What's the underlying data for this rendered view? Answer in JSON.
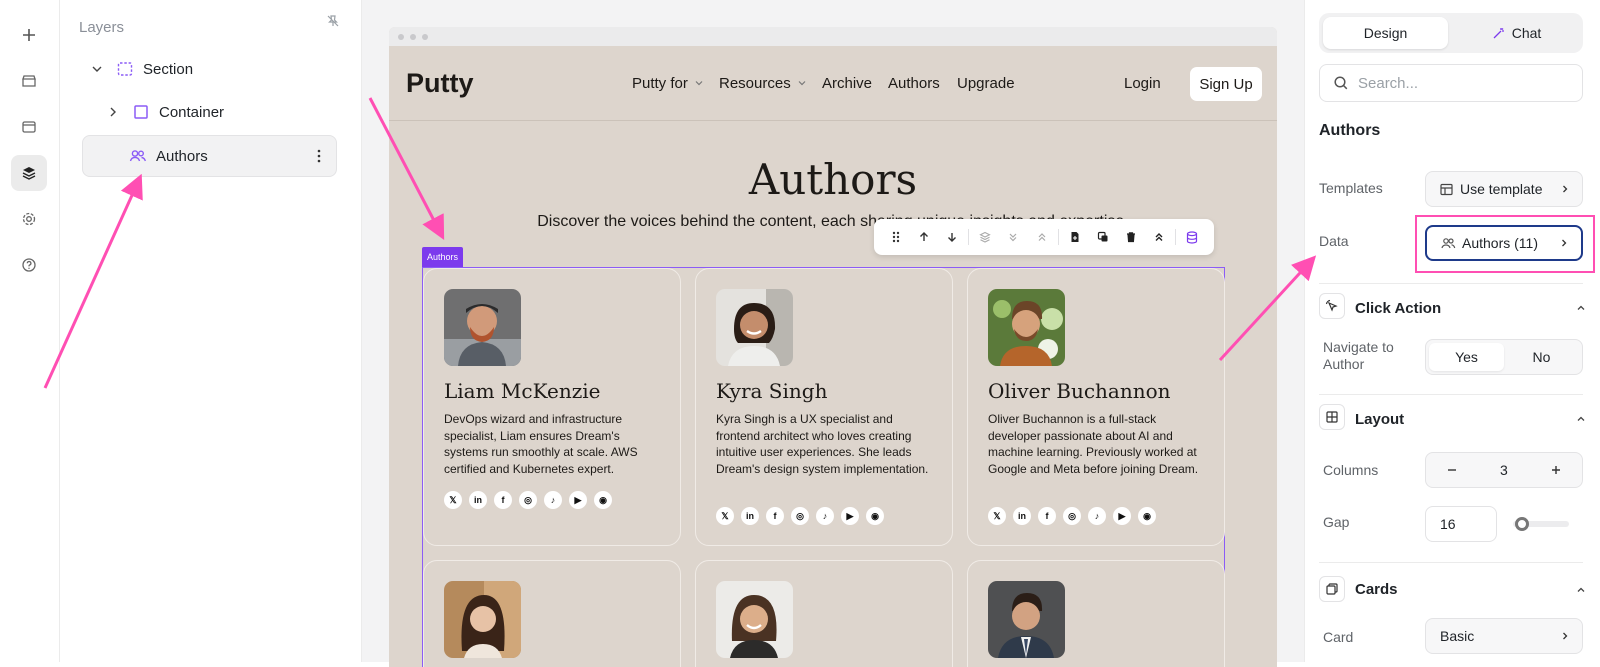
{
  "rail": {
    "icons": [
      "plus-icon",
      "box-icon",
      "window-icon",
      "layers-icon",
      "gear-icon",
      "help-icon"
    ]
  },
  "layers": {
    "title": "Layers",
    "tree": [
      {
        "label": "Section"
      },
      {
        "label": "Container"
      },
      {
        "label": "Authors"
      }
    ]
  },
  "site": {
    "brand": "Putty",
    "nav": [
      "Putty for",
      "Resources",
      "Archive",
      "Authors",
      "Upgrade"
    ],
    "login": "Login",
    "signup": "Sign Up",
    "hero_title": "Authors",
    "hero_sub": "Discover the voices behind the content, each sharing unique insights and expertise.",
    "grid_tag": "Authors",
    "cards": [
      {
        "name": "Liam McKenzie",
        "bio": "DevOps wizard and infrastructure specialist, Liam ensures Dream's systems run smoothly at scale. AWS certified and Kubernetes expert."
      },
      {
        "name": "Kyra Singh",
        "bio": "Kyra Singh is a UX specialist and frontend architect who loves creating intuitive user experiences. She leads Dream's design system implementation."
      },
      {
        "name": "Oliver Buchannon",
        "bio": "Oliver Buchannon is a full-stack developer passionate about AI and machine learning. Previously worked at Google and Meta before joining Dream."
      },
      {
        "name": "",
        "bio": ""
      },
      {
        "name": "",
        "bio": ""
      },
      {
        "name": "",
        "bio": ""
      }
    ],
    "social_glyphs": [
      "𝕏",
      "in",
      "f",
      "◎",
      "♪",
      "▶",
      "◉"
    ]
  },
  "props": {
    "tabs": [
      "Design",
      "Chat"
    ],
    "search_placeholder": "Search...",
    "component_title": "Authors",
    "templates_label": "Templates",
    "templates_value": "Use template",
    "data_label": "Data",
    "data_value": "Authors (11)",
    "click_action": {
      "title": "Click Action",
      "label": "Navigate to Author",
      "yes": "Yes",
      "no": "No"
    },
    "layout": {
      "title": "Layout",
      "columns_label": "Columns",
      "columns_value": "3",
      "gap_label": "Gap",
      "gap_value": "16",
      "gap_fraction": 0.04
    },
    "cards": {
      "title": "Cards",
      "card_label": "Card",
      "card_value": "Basic"
    }
  },
  "colors": {
    "accent": "#7c3aed",
    "annotation": "#ff4fb3",
    "canvas_bg": "#ddd5cd"
  }
}
